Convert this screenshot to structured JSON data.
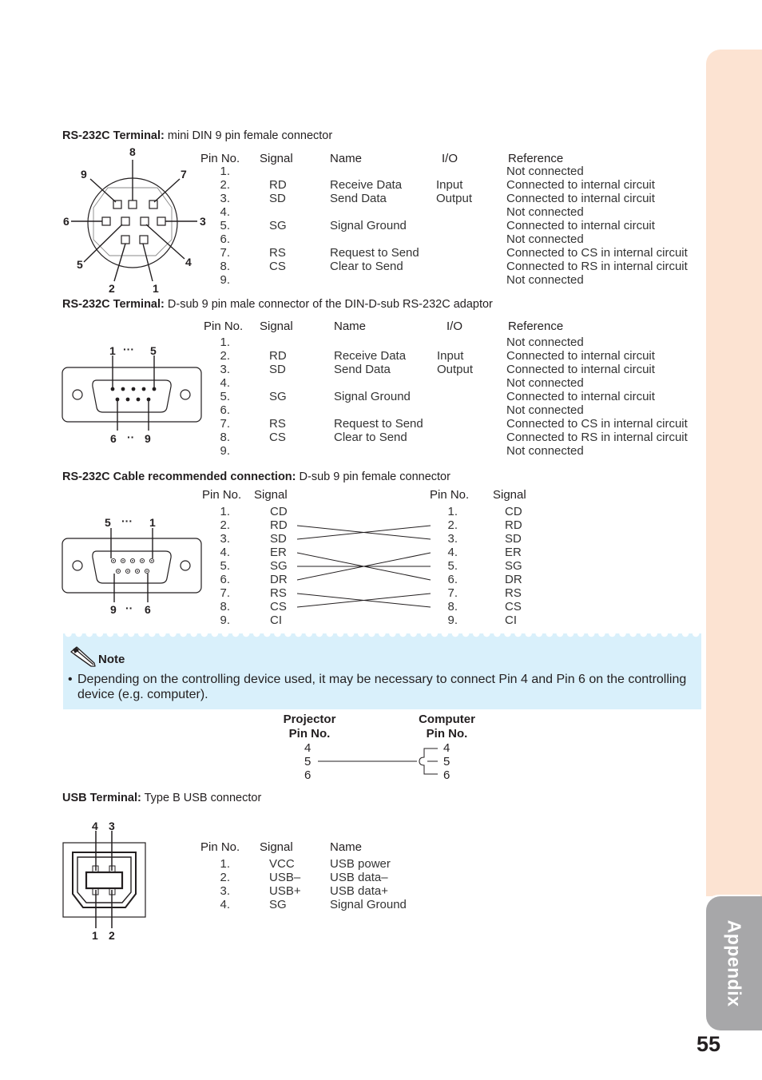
{
  "side_tab": {
    "label": "Appendix"
  },
  "page_number": "55",
  "section1": {
    "heading_bold": "RS-232C Terminal:",
    "heading_rest": " mini DIN 9 pin female connector",
    "diagram_pin_labels": [
      "1",
      "2",
      "3",
      "4",
      "5",
      "6",
      "7",
      "8",
      "9"
    ],
    "headers": {
      "pin": "Pin No.",
      "signal": "Signal",
      "name": "Name",
      "io": "I/O",
      "reference": "Reference"
    },
    "rows": [
      {
        "pin": "1.",
        "signal": "",
        "name": "",
        "io": "",
        "reference": "Not connected"
      },
      {
        "pin": "2.",
        "signal": "RD",
        "name": "Receive Data",
        "io": "Input",
        "reference": "Connected to internal circuit"
      },
      {
        "pin": "3.",
        "signal": "SD",
        "name": "Send Data",
        "io": "Output",
        "reference": "Connected to internal circuit"
      },
      {
        "pin": "4.",
        "signal": "",
        "name": "",
        "io": "",
        "reference": "Not connected"
      },
      {
        "pin": "5.",
        "signal": "SG",
        "name": "Signal Ground",
        "io": "",
        "reference": "Connected to internal circuit"
      },
      {
        "pin": "6.",
        "signal": "",
        "name": "",
        "io": "",
        "reference": "Not connected"
      },
      {
        "pin": "7.",
        "signal": "RS",
        "name": "Request to Send",
        "io": "",
        "reference": "Connected to CS in internal circuit"
      },
      {
        "pin": "8.",
        "signal": "CS",
        "name": "Clear to Send",
        "io": "",
        "reference": "Connected to RS in internal circuit"
      },
      {
        "pin": "9.",
        "signal": "",
        "name": "",
        "io": "",
        "reference": "Not connected"
      }
    ]
  },
  "section2": {
    "heading_bold": "RS-232C Terminal:",
    "heading_rest": " D-sub 9 pin male connector of the DIN-D-sub RS-232C adaptor",
    "diagram_labels": {
      "top_left": "1",
      "top_dots": "···",
      "top_right": "5",
      "bottom_left": "6",
      "bottom_dots": "··",
      "bottom_right": "9"
    },
    "headers": {
      "pin": "Pin No.",
      "signal": "Signal",
      "name": "Name",
      "io": "I/O",
      "reference": "Reference"
    },
    "rows": [
      {
        "pin": "1.",
        "signal": "",
        "name": "",
        "io": "",
        "reference": "Not connected"
      },
      {
        "pin": "2.",
        "signal": "RD",
        "name": "Receive Data",
        "io": "Input",
        "reference": "Connected to internal circuit"
      },
      {
        "pin": "3.",
        "signal": "SD",
        "name": "Send Data",
        "io": "Output",
        "reference": "Connected to internal circuit"
      },
      {
        "pin": "4.",
        "signal": "",
        "name": "",
        "io": "",
        "reference": "Not connected"
      },
      {
        "pin": "5.",
        "signal": "SG",
        "name": "Signal Ground",
        "io": "",
        "reference": "Connected to internal circuit"
      },
      {
        "pin": "6.",
        "signal": "",
        "name": "",
        "io": "",
        "reference": "Not connected"
      },
      {
        "pin": "7.",
        "signal": "RS",
        "name": "Request to Send",
        "io": "",
        "reference": "Connected to CS in internal circuit"
      },
      {
        "pin": "8.",
        "signal": "CS",
        "name": "Clear to Send",
        "io": "",
        "reference": "Connected to RS in internal circuit"
      },
      {
        "pin": "9.",
        "signal": "",
        "name": "",
        "io": "",
        "reference": "Not connected"
      }
    ]
  },
  "section3": {
    "heading_bold": "RS-232C Cable recommended connection:",
    "heading_rest": " D-sub 9 pin female connector",
    "diagram_labels": {
      "top_left": "5",
      "top_dots": "···",
      "top_right": "1",
      "bottom_left": "9",
      "bottom_dots": "··",
      "bottom_right": "6"
    },
    "headers": {
      "pin": "Pin No.",
      "signal": "Signal"
    },
    "left": [
      {
        "pin": "1.",
        "signal": "CD"
      },
      {
        "pin": "2.",
        "signal": "RD"
      },
      {
        "pin": "3.",
        "signal": "SD"
      },
      {
        "pin": "4.",
        "signal": "ER"
      },
      {
        "pin": "5.",
        "signal": "SG"
      },
      {
        "pin": "6.",
        "signal": "DR"
      },
      {
        "pin": "7.",
        "signal": "RS"
      },
      {
        "pin": "8.",
        "signal": "CS"
      },
      {
        "pin": "9.",
        "signal": "CI"
      }
    ],
    "right": [
      {
        "pin": "1.",
        "signal": "CD"
      },
      {
        "pin": "2.",
        "signal": "RD"
      },
      {
        "pin": "3.",
        "signal": "SD"
      },
      {
        "pin": "4.",
        "signal": "ER"
      },
      {
        "pin": "5.",
        "signal": "SG"
      },
      {
        "pin": "6.",
        "signal": "DR"
      },
      {
        "pin": "7.",
        "signal": "RS"
      },
      {
        "pin": "8.",
        "signal": "CS"
      },
      {
        "pin": "9.",
        "signal": "CI"
      }
    ],
    "connections": [
      [
        2,
        3
      ],
      [
        3,
        2
      ],
      [
        4,
        6
      ],
      [
        5,
        5
      ],
      [
        6,
        4
      ],
      [
        7,
        8
      ],
      [
        8,
        7
      ]
    ]
  },
  "note": {
    "title": "Note",
    "bullet": "•",
    "text": "Depending on the controlling device used, it may be necessary to connect Pin 4 and Pin 6 on the controlling device (e.g. computer).",
    "projector_label_1": "Projector",
    "projector_label_2": "Pin No.",
    "computer_label_1": "Computer",
    "computer_label_2": "Pin No.",
    "projector_pins": [
      "4",
      "5",
      "6"
    ],
    "computer_pins": [
      "4",
      "5",
      "6"
    ]
  },
  "section4": {
    "heading_bold": "USB Terminal:",
    "heading_rest": " Type B USB connector",
    "diagram_labels": {
      "top_left": "4",
      "top_right": "3",
      "bottom_left": "1",
      "bottom_right": "2"
    },
    "headers": {
      "pin": "Pin No.",
      "signal": "Signal",
      "name": "Name"
    },
    "rows": [
      {
        "pin": "1.",
        "signal": "VCC",
        "name": "USB power"
      },
      {
        "pin": "2.",
        "signal": "USB–",
        "name": "USB data–"
      },
      {
        "pin": "3.",
        "signal": "USB+",
        "name": "USB data+"
      },
      {
        "pin": "4.",
        "signal": "SG",
        "name": "Signal Ground"
      }
    ]
  }
}
